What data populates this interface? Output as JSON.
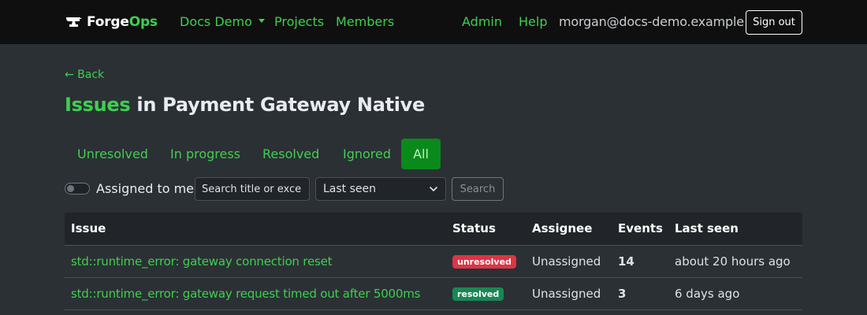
{
  "colors": {
    "accent": "#3fcf4f",
    "navbar_bg": "#0f0f0f",
    "page_bg": "#2b3035",
    "active_tab_bg": "#0a8a1a",
    "badge_unresolved": "#dc3545",
    "badge_resolved": "#198754"
  },
  "navbar": {
    "brand_first": "Forge",
    "brand_second": "Ops",
    "brand_icon": "anvil-icon",
    "org_label": "Docs Demo",
    "projects_label": "Projects",
    "members_label": "Members",
    "admin_label": "Admin",
    "help_label": "Help",
    "user_email": "morgan@docs-demo.example",
    "signout_label": "Sign out"
  },
  "page": {
    "back_label": "← Back",
    "title_accent": "Issues",
    "title_rest": " in Payment Gateway Native"
  },
  "filters": {
    "tabs": [
      {
        "label": "Unresolved",
        "active": false
      },
      {
        "label": "In progress",
        "active": false
      },
      {
        "label": "Resolved",
        "active": false
      },
      {
        "label": "Ignored",
        "active": false
      },
      {
        "label": "All",
        "active": true
      }
    ],
    "assigned_label": "Assigned to me",
    "assigned_on": false,
    "search_placeholder": "Search title or exce",
    "sort_value": "Last seen",
    "search_button": "Search"
  },
  "table": {
    "headers": {
      "issue": "Issue",
      "status": "Status",
      "assignee": "Assignee",
      "events": "Events",
      "last_seen": "Last seen"
    },
    "rows": [
      {
        "issue": "std::runtime_error: gateway connection reset",
        "status": "unresolved",
        "assignee": "Unassigned",
        "events": "14",
        "last_seen": "about 20 hours ago"
      },
      {
        "issue": "std::runtime_error: gateway request timed out after 5000ms",
        "status": "resolved",
        "assignee": "Unassigned",
        "events": "3",
        "last_seen": "6 days ago"
      }
    ]
  }
}
